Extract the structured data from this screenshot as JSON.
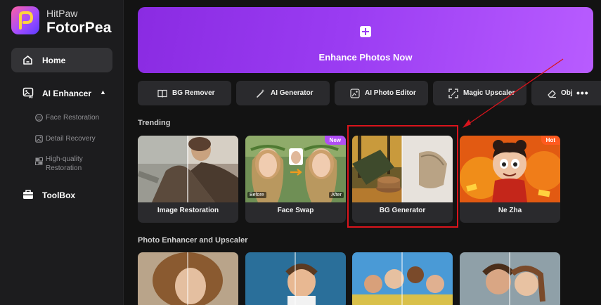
{
  "brand": {
    "top": "HitPaw",
    "bottom": "FotorPea"
  },
  "sidebar": {
    "home": "Home",
    "ai_enhancer": "AI Enhancer",
    "sub_items": [
      {
        "label": "Face Restoration",
        "icon": "face-icon"
      },
      {
        "label": "Detail Recovery",
        "icon": "image-icon"
      },
      {
        "label_line1": "High-quality",
        "label_line2": "Restoration",
        "icon": "grid-icon"
      }
    ],
    "toolbox": "ToolBox"
  },
  "hero": {
    "label": "Enhance Photos Now",
    "icon": "plus-icon",
    "colors": [
      "#8a2be2",
      "#b85cff"
    ]
  },
  "tools": [
    {
      "label": "BG Remover",
      "icon": "book-icon"
    },
    {
      "label": "AI Generator",
      "icon": "magic-wand-icon"
    },
    {
      "label": "AI Photo Editor",
      "icon": "photo-edit-icon"
    },
    {
      "label": "Magic Upscaler",
      "icon": "expand-icon"
    },
    {
      "label": "Obj",
      "icon": "eraser-icon"
    }
  ],
  "more_label": "•••",
  "trending": {
    "title": "Trending",
    "cards": [
      {
        "label": "Image Restoration"
      },
      {
        "label": "Face Swap",
        "badge": "New",
        "before": "Before",
        "after": "After"
      },
      {
        "label": "BG Generator"
      },
      {
        "label": "Ne Zha",
        "badge": "Hot"
      }
    ]
  },
  "upscaler": {
    "title": "Photo Enhancer and Upscaler"
  },
  "colors": {
    "highlight": "#d9141c",
    "badge_new": "#b14ef5",
    "badge_hot": "#ff5a1f"
  }
}
